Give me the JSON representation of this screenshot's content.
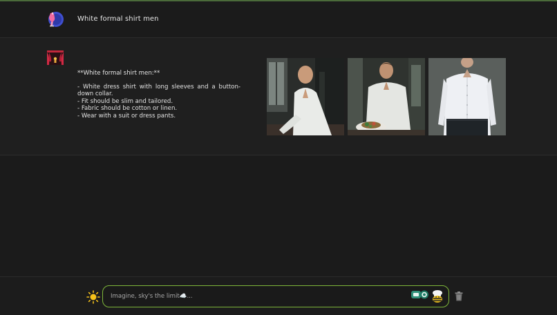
{
  "conversation": {
    "user_message": "White formal shirt men",
    "bot_message": {
      "heading": "**White formal shirt men:**",
      "lines": [
        "- White dress shirt with long sleeves and a button-down collar.",
        "- Fit should be slim and tailored.",
        "- Fabric should be cotton or linen.",
        "- Wear with a suit or dress pants."
      ]
    }
  },
  "composer": {
    "placeholder": "Imagine, sky's the limit☁️..."
  },
  "icons": {
    "user_avatar": "mannequin-avatar-icon",
    "bot_avatar": "theater-curtain-avatar-icon",
    "theme_toggle": "sun-icon",
    "mode_toggle": "speech-bubbles-icon",
    "assistant": "chef-bee-icon",
    "clear": "trash-icon"
  },
  "colors": {
    "accent": "#7fb83a",
    "background": "#1b1b1b",
    "bot_row": "#1f1f1f"
  }
}
